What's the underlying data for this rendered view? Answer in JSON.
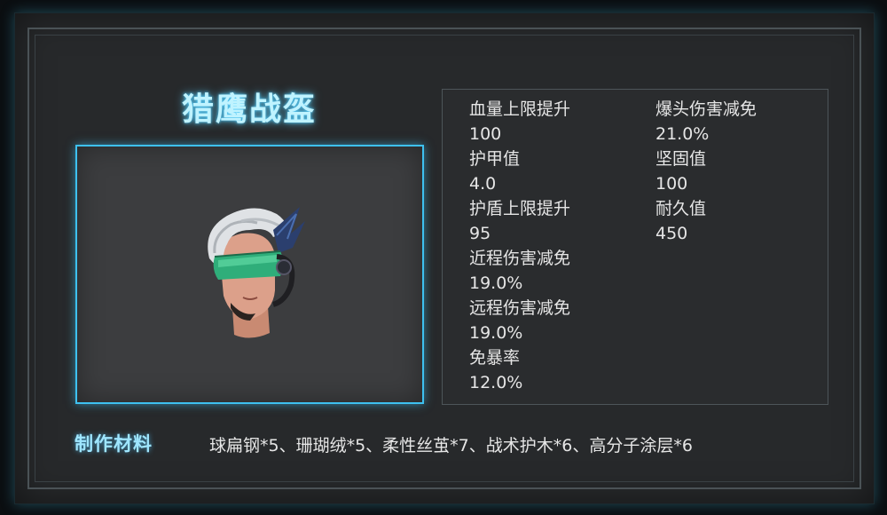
{
  "item": {
    "title": "猎鹰战盔",
    "preview_icon": "helmet-icon"
  },
  "stats": {
    "left": [
      {
        "label": "血量上限提升",
        "value": "100"
      },
      {
        "label": "护甲值",
        "value": "4.0"
      },
      {
        "label": "护盾上限提升",
        "value": "95"
      },
      {
        "label": "近程伤害减免",
        "value": "19.0%"
      },
      {
        "label": "远程伤害减免",
        "value": "19.0%"
      },
      {
        "label": "免暴率",
        "value": "12.0%"
      }
    ],
    "right": [
      {
        "label": "爆头伤害减免",
        "value": "21.0%"
      },
      {
        "label": "坚固值",
        "value": "100"
      },
      {
        "label": "耐久值",
        "value": "450"
      }
    ]
  },
  "materials": {
    "label": "制作材料",
    "value": "球扁钢*5、珊瑚绒*5、柔性丝茧*7、战术护木*6、高分子涂层*6"
  },
  "colors": {
    "accent": "#3ec1f0",
    "title_glow": "#bff3ff",
    "panel": "#27292b",
    "visor": "#2fae7a"
  }
}
